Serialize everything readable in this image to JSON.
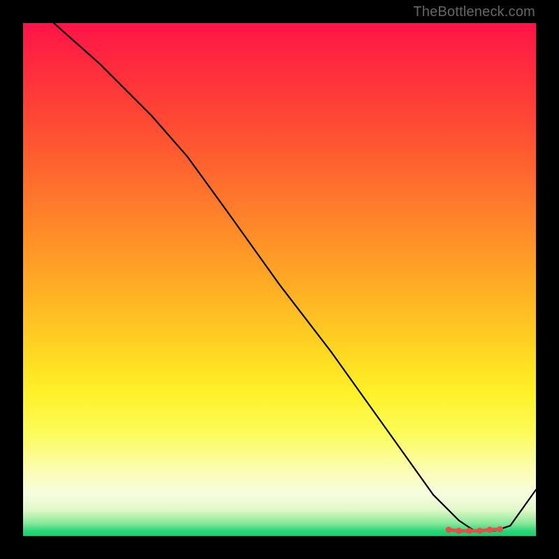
{
  "watermark": "TheBottleneck.com",
  "chart_data": {
    "type": "line",
    "title": "",
    "xlabel": "",
    "ylabel": "",
    "xlim": [
      0,
      100
    ],
    "ylim": [
      0,
      100
    ],
    "gradient_bands": [
      {
        "pos": 0,
        "color": "#ff1448"
      },
      {
        "pos": 30,
        "color": "#ff6a2e"
      },
      {
        "pos": 60,
        "color": "#ffd722"
      },
      {
        "pos": 85,
        "color": "#fcfdb0"
      },
      {
        "pos": 100,
        "color": "#16d072"
      }
    ],
    "series": [
      {
        "name": "curve",
        "x": [
          6,
          15,
          25,
          32,
          40,
          50,
          60,
          70,
          80,
          85,
          88,
          92,
          95,
          100
        ],
        "values": [
          100,
          92,
          82,
          74,
          63,
          49,
          36,
          22,
          8,
          3,
          1,
          1,
          2,
          9
        ]
      }
    ],
    "markers": {
      "name": "highlight-band",
      "x": [
        83,
        85,
        87,
        89,
        91,
        93
      ],
      "values": [
        1.2,
        1.0,
        1.0,
        1.0,
        1.2,
        1.3
      ],
      "color": "#e1524b"
    }
  }
}
